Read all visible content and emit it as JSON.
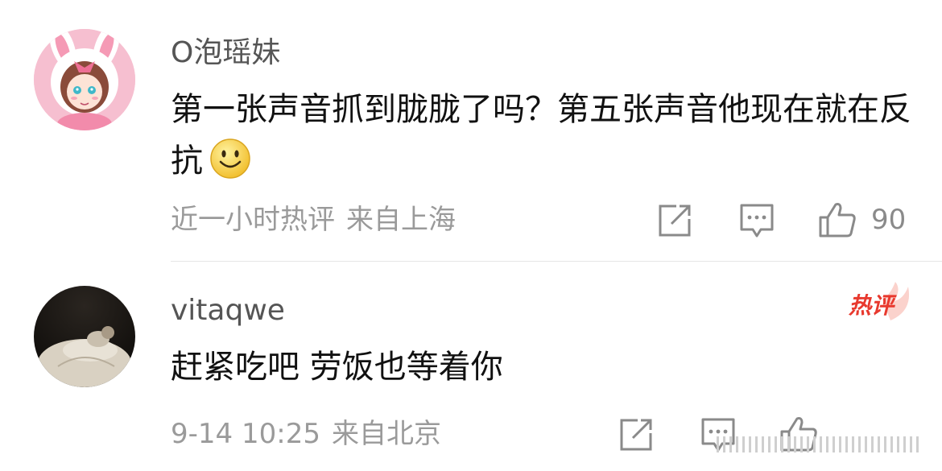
{
  "comments": [
    {
      "username": "O泡瑶妹",
      "text": "第一张声音抓到胧胧了吗？第五张声音他现在就在反抗",
      "emoji": "smile-emoji",
      "time": "近一小时热评",
      "location": "来自上海",
      "likes": "90",
      "avatar": "anime-bunny-girl-avatar"
    },
    {
      "username": "vitaqwe",
      "text": "赶紧吃吧 劳饭也等着你",
      "time": "9-14 10:25",
      "location": "来自北京",
      "badge": "热评",
      "likes": "",
      "avatar": "dark-photo-avatar"
    }
  ],
  "icons": {
    "share": "share-edit-icon",
    "reply": "comment-bubble-icon",
    "like": "thumbs-up-icon"
  },
  "colors": {
    "hot_badge": "#e8392e",
    "meta_text": "#9a9a9a",
    "icon_stroke": "#8a8a8a"
  }
}
